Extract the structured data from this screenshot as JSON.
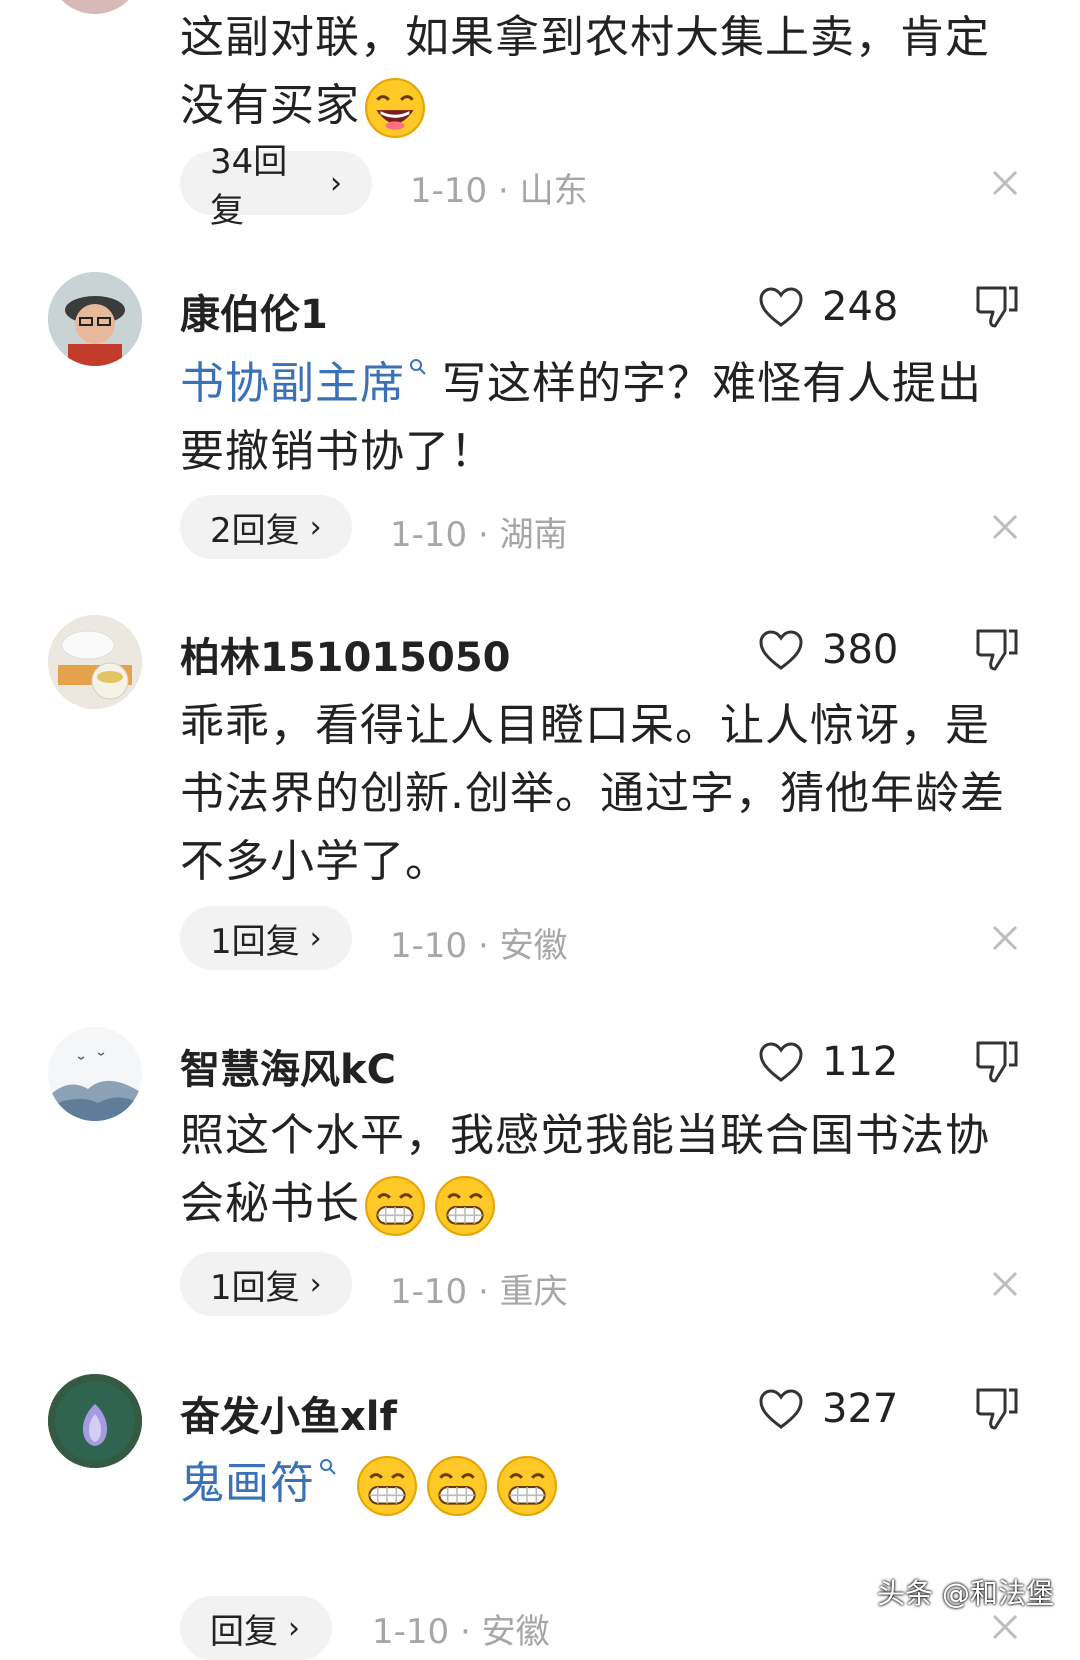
{
  "comments": [
    {
      "username": "",
      "text_parts": [
        "这副对联，如果拿到农村大集上卖，肯定没有买家"
      ],
      "emojis": [
        "laughing-emoji"
      ],
      "replies": "34回复",
      "date": "1-10",
      "location": "山东",
      "like_count": ""
    },
    {
      "username": "康伯伦1",
      "link_text": "书协副主席",
      "text_parts": [
        "写这样的字？难怪有人提出要撤销书协了！"
      ],
      "replies": "2回复",
      "date": "1-10",
      "location": "湖南",
      "like_count": "248"
    },
    {
      "username": "柏林151015050",
      "text_parts": [
        "乖乖，看得让人目瞪口呆。让人惊讶，是书法界的创新.创举。通过字，猜他年龄差不多小学了。"
      ],
      "replies": "1回复",
      "date": "1-10",
      "location": "安徽",
      "like_count": "380"
    },
    {
      "username": "智慧海风kC",
      "text_parts": [
        "照这个水平，我感觉我能当联合国书法协会秘书长"
      ],
      "emojis": [
        "grinning-emoji",
        "grinning-emoji"
      ],
      "replies": "1回复",
      "date": "1-10",
      "location": "重庆",
      "like_count": "112"
    },
    {
      "username": "奋发小鱼xlf",
      "link_text": "鬼画符",
      "emojis": [
        "grinning-emoji",
        "grinning-emoji",
        "grinning-emoji"
      ],
      "replies": "回复",
      "date": "1-10",
      "location": "安徽",
      "like_count": "327"
    }
  ],
  "separator": "·",
  "chevron": "›",
  "watermark": "头条 @和法堡",
  "colors": {
    "link": "#3a71b7",
    "meta": "#a6a6a6",
    "pill": "#f2f2f2"
  }
}
